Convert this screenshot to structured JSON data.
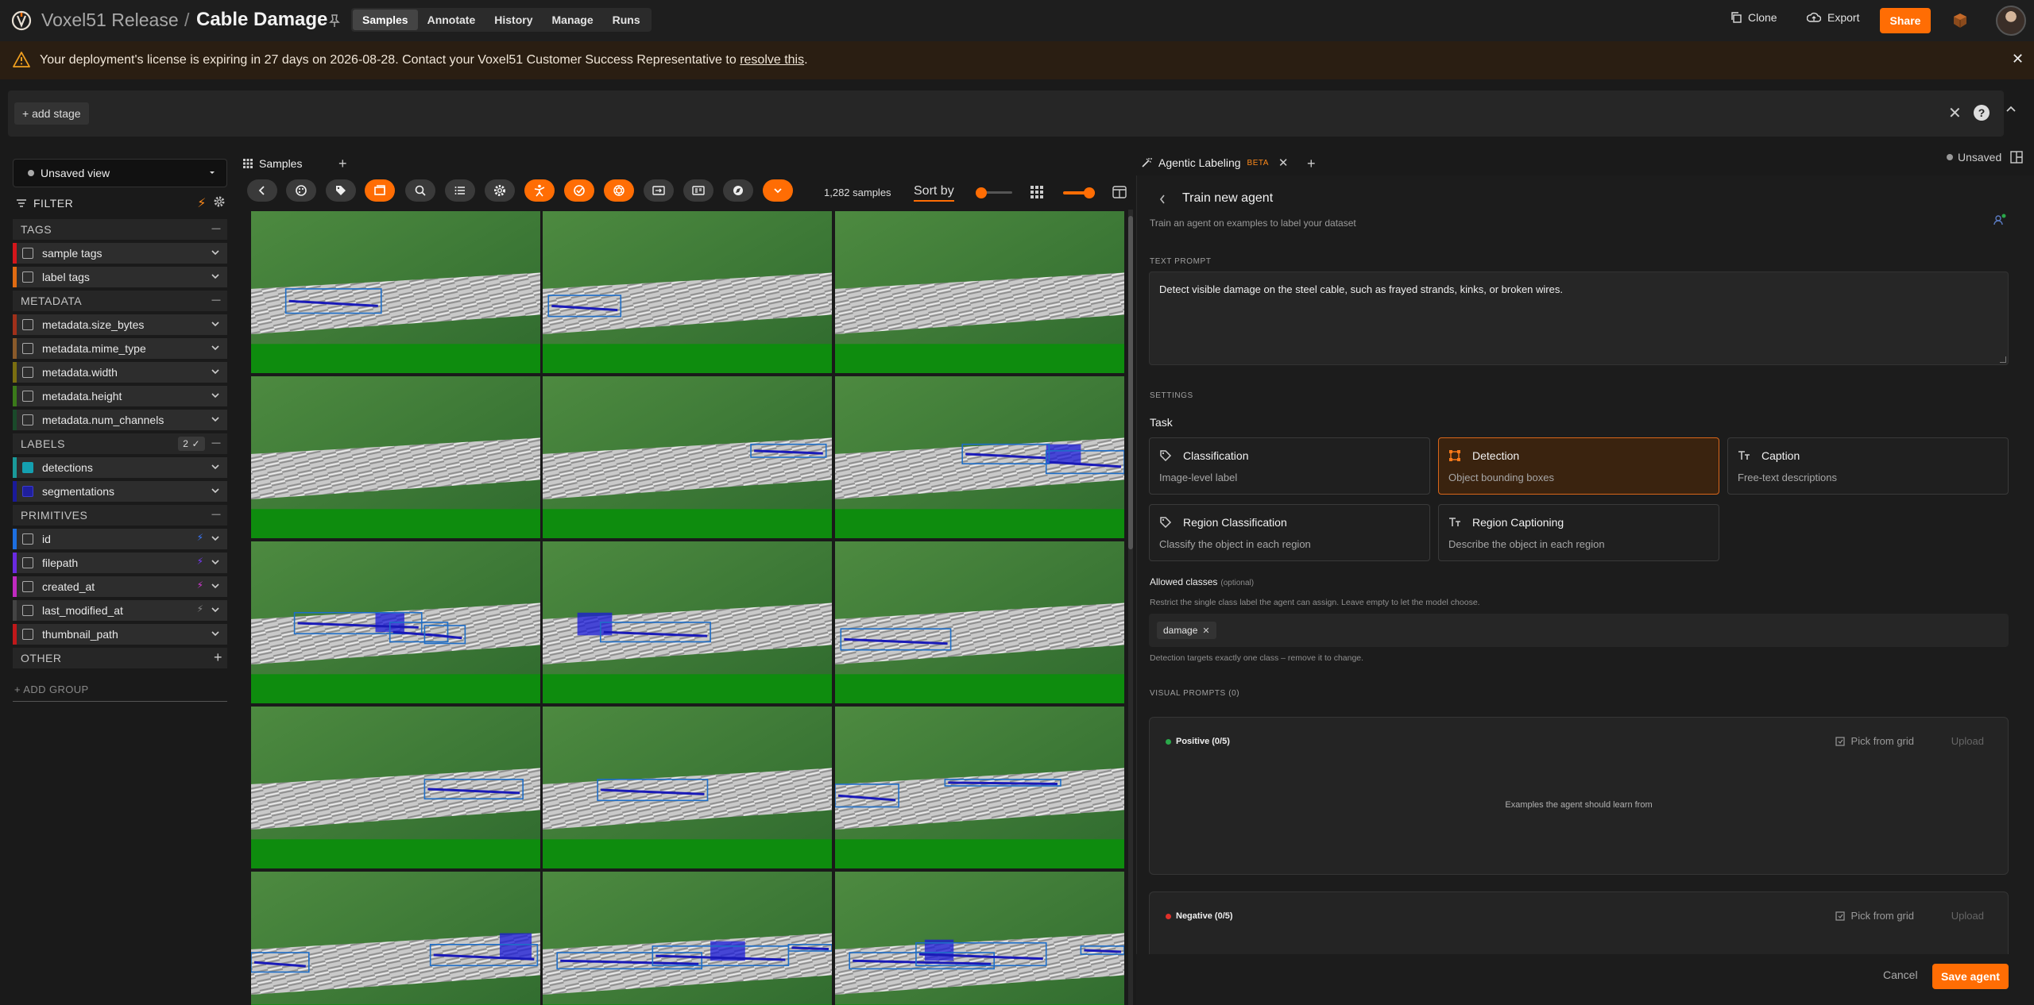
{
  "header": {
    "dataset": "Voxel51 Release",
    "separator": "/",
    "dataset_name": "Cable Damage",
    "modes": [
      "Samples",
      "Annotate",
      "History",
      "Manage",
      "Runs"
    ],
    "active_mode": "Samples",
    "clone_label": "Clone",
    "export_label": "Export",
    "share_label": "Share"
  },
  "banner": {
    "text": "Your deployment's license is expiring in 27 days on 2026-08-28. Contact your Voxel51 Customer Success Representative to ",
    "link": "resolve this",
    "end": "."
  },
  "viewbar": {
    "add_stage": "+ add stage"
  },
  "sidebar": {
    "view_select": "Unsaved view",
    "filter_label": "FILTER",
    "groups": {
      "tags": "TAGS",
      "metadata": "METADATA",
      "labels": "LABELS",
      "labels_count": "2",
      "primitives": "PRIMITIVES",
      "other": "OTHER"
    },
    "tags": [
      {
        "label": "sample tags",
        "color": "#d4161b"
      },
      {
        "label": "label tags",
        "color": "#e06b12"
      }
    ],
    "metadata": [
      {
        "label": "metadata.size_bytes",
        "color": "#a0301a"
      },
      {
        "label": "metadata.mime_type",
        "color": "#8a5a2a"
      },
      {
        "label": "metadata.width",
        "color": "#7a6e10"
      },
      {
        "label": "metadata.height",
        "color": "#3a7a1a"
      },
      {
        "label": "metadata.num_channels",
        "color": "#1a4a2a"
      }
    ],
    "labels": [
      {
        "label": "detections",
        "color": "#1a9a9a",
        "checked": true
      },
      {
        "label": "segmentations",
        "color": "#1a1a9a",
        "checked": true
      }
    ],
    "primitives": [
      {
        "label": "id",
        "color": "#1d6fe0",
        "bolt": "#3a7aff"
      },
      {
        "label": "filepath",
        "color": "#6a2ae0",
        "bolt": "#7a3aff"
      },
      {
        "label": "created_at",
        "color": "#c02ac0",
        "bolt": "#d23ad2"
      },
      {
        "label": "last_modified_at",
        "color": "#444444",
        "bolt": "#888888"
      },
      {
        "label": "thumbnail_path",
        "color": "#c0181a",
        "bolt": null
      }
    ],
    "add_group": "+ ADD GROUP"
  },
  "grid": {
    "tab_label": "Samples",
    "sample_count": "1,282 samples",
    "sort_by": "Sort by",
    "toolbar_icons": [
      "back-icon",
      "palette-icon",
      "tag-icon",
      "crop-icon",
      "search-icon",
      "list-icon",
      "gear-icon",
      "person-pose-icon",
      "check-circle-icon",
      "openai-icon",
      "import-icon",
      "info-card-icon",
      "map-icon",
      "chevron-down-icon"
    ],
    "tiles": [
      {
        "boxes": [
          [
            0.12,
            0.48,
            0.33,
            0.15
          ]
        ],
        "mask": null
      },
      {
        "boxes": [
          [
            0.02,
            0.52,
            0.25,
            0.13
          ]
        ],
        "mask": null
      },
      {
        "boxes": [],
        "mask": null
      },
      {
        "boxes": [],
        "mask": null
      },
      {
        "boxes": [
          [
            0.72,
            0.42,
            0.26,
            0.08
          ]
        ],
        "mask": null
      },
      {
        "boxes": [
          [
            0.44,
            0.42,
            0.3,
            0.12
          ],
          [
            0.73,
            0.46,
            0.27,
            0.14
          ]
        ],
        "mask": [
          0.73,
          0.42,
          0.12,
          0.12
        ]
      },
      {
        "boxes": [
          [
            0.15,
            0.44,
            0.44,
            0.13
          ],
          [
            0.48,
            0.5,
            0.2,
            0.12
          ],
          [
            0.6,
            0.52,
            0.14,
            0.11
          ]
        ],
        "mask": [
          0.43,
          0.44,
          0.1,
          0.12
        ]
      },
      {
        "boxes": [
          [
            0.2,
            0.5,
            0.38,
            0.12
          ]
        ],
        "mask": [
          0.12,
          0.44,
          0.12,
          0.14
        ]
      },
      {
        "boxes": [
          [
            0.02,
            0.54,
            0.38,
            0.13
          ]
        ],
        "mask": null
      },
      {
        "boxes": [
          [
            0.6,
            0.45,
            0.34,
            0.12
          ]
        ],
        "mask": null
      },
      {
        "boxes": [
          [
            0.19,
            0.45,
            0.38,
            0.13
          ]
        ],
        "mask": null
      },
      {
        "boxes": [
          [
            0.38,
            0.45,
            0.4,
            0.04
          ],
          [
            0.0,
            0.48,
            0.22,
            0.14
          ]
        ],
        "mask": null
      },
      {
        "boxes": [
          [
            0.62,
            0.45,
            0.37,
            0.13
          ],
          [
            0.0,
            0.5,
            0.2,
            0.12
          ]
        ],
        "mask": [
          0.86,
          0.38,
          0.11,
          0.16
        ]
      },
      {
        "boxes": [
          [
            0.05,
            0.5,
            0.5,
            0.1
          ],
          [
            0.38,
            0.46,
            0.47,
            0.12
          ],
          [
            0.85,
            0.45,
            0.15,
            0.04
          ]
        ],
        "mask": [
          0.58,
          0.43,
          0.12,
          0.12
        ]
      },
      {
        "boxes": [
          [
            0.05,
            0.5,
            0.5,
            0.1
          ],
          [
            0.28,
            0.44,
            0.45,
            0.14
          ],
          [
            0.85,
            0.46,
            0.15,
            0.05
          ]
        ],
        "mask": [
          0.31,
          0.42,
          0.1,
          0.13
        ]
      }
    ]
  },
  "right_panel": {
    "tab_label": "Agentic Labeling",
    "beta": "BETA",
    "unsaved": "Unsaved",
    "title": "Train new agent",
    "subtitle": "Train an agent on examples to label your dataset",
    "text_prompt_label": "TEXT PROMPT",
    "text_prompt": "Detect visible damage on the steel cable, such as frayed strands, kinks, or broken wires.",
    "settings_label": "SETTINGS",
    "task_label": "Task",
    "tasks": [
      {
        "name": "Classification",
        "desc": "Image-level label",
        "icon": "tag-icon",
        "selected": false
      },
      {
        "name": "Detection",
        "desc": "Object bounding boxes",
        "icon": "bounding-box-icon",
        "selected": true
      },
      {
        "name": "Caption",
        "desc": "Free-text descriptions",
        "icon": "text-icon",
        "selected": false
      },
      {
        "name": "Region Classification",
        "desc": "Classify the object in each region",
        "icon": "tag-icon",
        "selected": false
      },
      {
        "name": "Region Captioning",
        "desc": "Describe the object in each region",
        "icon": "text-icon",
        "selected": false
      }
    ],
    "allowed_label": "Allowed classes",
    "allowed_optional": "(optional)",
    "allowed_help": "Restrict the single class label the agent can assign. Leave empty to let the model choose.",
    "allowed_chip": "damage",
    "chip_help": "Detection targets exactly one class – remove it to change.",
    "visual_prompts_label": "VISUAL PROMPTS (0)",
    "positive": {
      "label": "Positive (0/5)",
      "color": "#2aa84a",
      "pick": "Pick from grid",
      "upload": "Upload",
      "empty": "Examples the agent should learn from"
    },
    "negative": {
      "label": "Negative (0/5)",
      "color": "#e0302a",
      "pick": "Pick from grid",
      "upload": "Upload"
    },
    "cancel": "Cancel",
    "save": "Save agent"
  },
  "colors": {
    "accent": "#ff6d04",
    "background": "#1a1a1a",
    "panel": "#1c1c1c"
  }
}
